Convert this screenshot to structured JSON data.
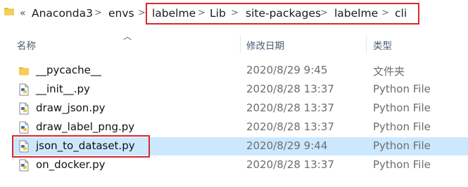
{
  "breadcrumb": {
    "overflow": "«",
    "items": [
      "Anaconda3",
      "envs",
      "labelme",
      "Lib",
      "site-packages",
      "labelme",
      "cli"
    ],
    "separator": ">"
  },
  "columns": {
    "name": "名称",
    "modified": "修改日期",
    "type": "类型"
  },
  "files": [
    {
      "name": "__pycache__",
      "modified": "2020/8/29 9:45",
      "type": "文件夹",
      "icon": "folder-icon"
    },
    {
      "name": "__init__.py",
      "modified": "2020/8/28 13:37",
      "type": "Python File",
      "icon": "python-file-icon"
    },
    {
      "name": "draw_json.py",
      "modified": "2020/8/28 13:37",
      "type": "Python File",
      "icon": "python-file-icon"
    },
    {
      "name": "draw_label_png.py",
      "modified": "2020/8/28 13:37",
      "type": "Python File",
      "icon": "python-file-icon"
    },
    {
      "name": "json_to_dataset.py",
      "modified": "2020/8/29 9:44",
      "type": "Python File",
      "icon": "python-file-icon",
      "selected": true
    },
    {
      "name": "on_docker.py",
      "modified": "2020/8/28 13:37",
      "type": "Python File",
      "icon": "python-file-icon"
    }
  ],
  "colors": {
    "highlight_box": "#d9262c",
    "selection": "#cce8ff",
    "header_text": "#4a5a73"
  }
}
